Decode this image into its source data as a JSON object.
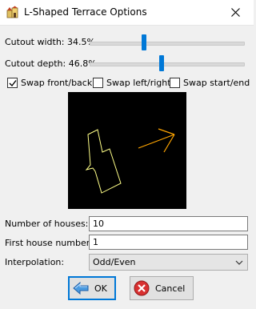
{
  "window": {
    "title": "L-Shaped Terrace Options",
    "app_icon": "terrace-app-icon",
    "close_icon": "close-icon"
  },
  "sliders": {
    "cutout_width": {
      "label": "Cutout width: 34.5%",
      "value_percent": 34.5
    },
    "cutout_depth": {
      "label": "Cutout depth: 46.8%",
      "value_percent": 46.8
    }
  },
  "checkboxes": [
    {
      "label": "Swap front/back",
      "checked": true
    },
    {
      "label": "Swap left/right",
      "checked": false
    },
    {
      "label": "Swap start/end",
      "checked": false
    }
  ],
  "preview": {
    "background": "#000000",
    "outline_color": "#ffff88",
    "arrow_color": "#ffa500"
  },
  "fields": {
    "number_of_houses": {
      "label": "Number of houses:",
      "value": "10"
    },
    "first_house_number": {
      "label": "First house number:",
      "value": "1"
    },
    "interpolation": {
      "label": "Interpolation:",
      "value": "Odd/Even"
    }
  },
  "buttons": {
    "ok": {
      "label": "OK",
      "icon": "ok-arrow-icon"
    },
    "cancel": {
      "label": "Cancel",
      "icon": "cancel-icon"
    }
  },
  "colors": {
    "accent": "#0078d7",
    "cancel_red": "#cc2222"
  }
}
